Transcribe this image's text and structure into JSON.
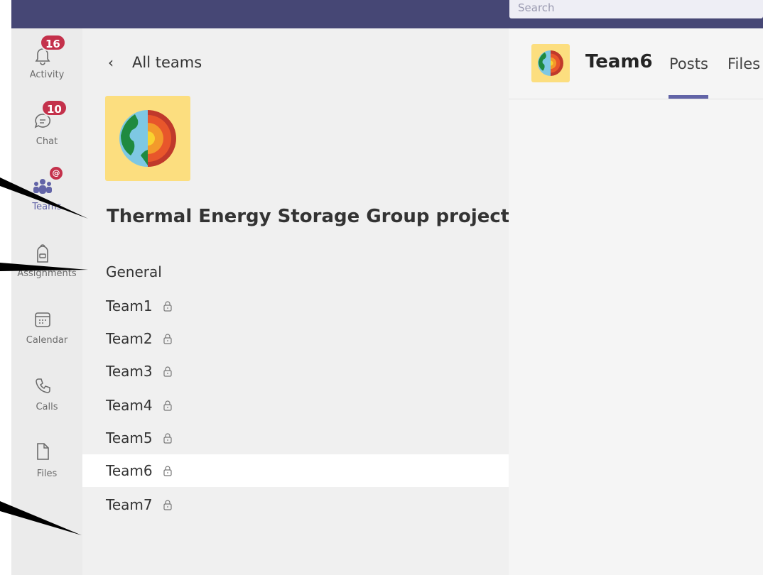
{
  "search": {
    "placeholder": "Search"
  },
  "rail": {
    "items": [
      {
        "label": "Activity",
        "icon": "bell-icon",
        "badge": "16"
      },
      {
        "label": "Chat",
        "icon": "chat-icon",
        "badge": "10"
      },
      {
        "label": "Teams",
        "icon": "teams-icon",
        "badge": "@"
      },
      {
        "label": "Assignments",
        "icon": "backpack-icon"
      },
      {
        "label": "Calendar",
        "icon": "calendar-icon"
      },
      {
        "label": "Calls",
        "icon": "phone-icon"
      },
      {
        "label": "Files",
        "icon": "file-icon"
      }
    ]
  },
  "panel": {
    "back_label": "All teams",
    "team_name": "Thermal Energy Storage Group projects",
    "channels": [
      {
        "name": "General",
        "private": false
      },
      {
        "name": "Team1",
        "private": true
      },
      {
        "name": "Team2",
        "private": true
      },
      {
        "name": "Team3",
        "private": true
      },
      {
        "name": "Team4",
        "private": true
      },
      {
        "name": "Team5",
        "private": true
      },
      {
        "name": "Team6",
        "private": true,
        "active": true
      },
      {
        "name": "Team7",
        "private": true
      }
    ]
  },
  "header": {
    "title": "Team6",
    "tabs": [
      "Posts",
      "Files"
    ],
    "active_tab": "Posts"
  },
  "colors": {
    "topbar": "#464775",
    "accent": "#6264a7",
    "badge": "#c4314b",
    "logo_bg": "#fcde7f"
  }
}
